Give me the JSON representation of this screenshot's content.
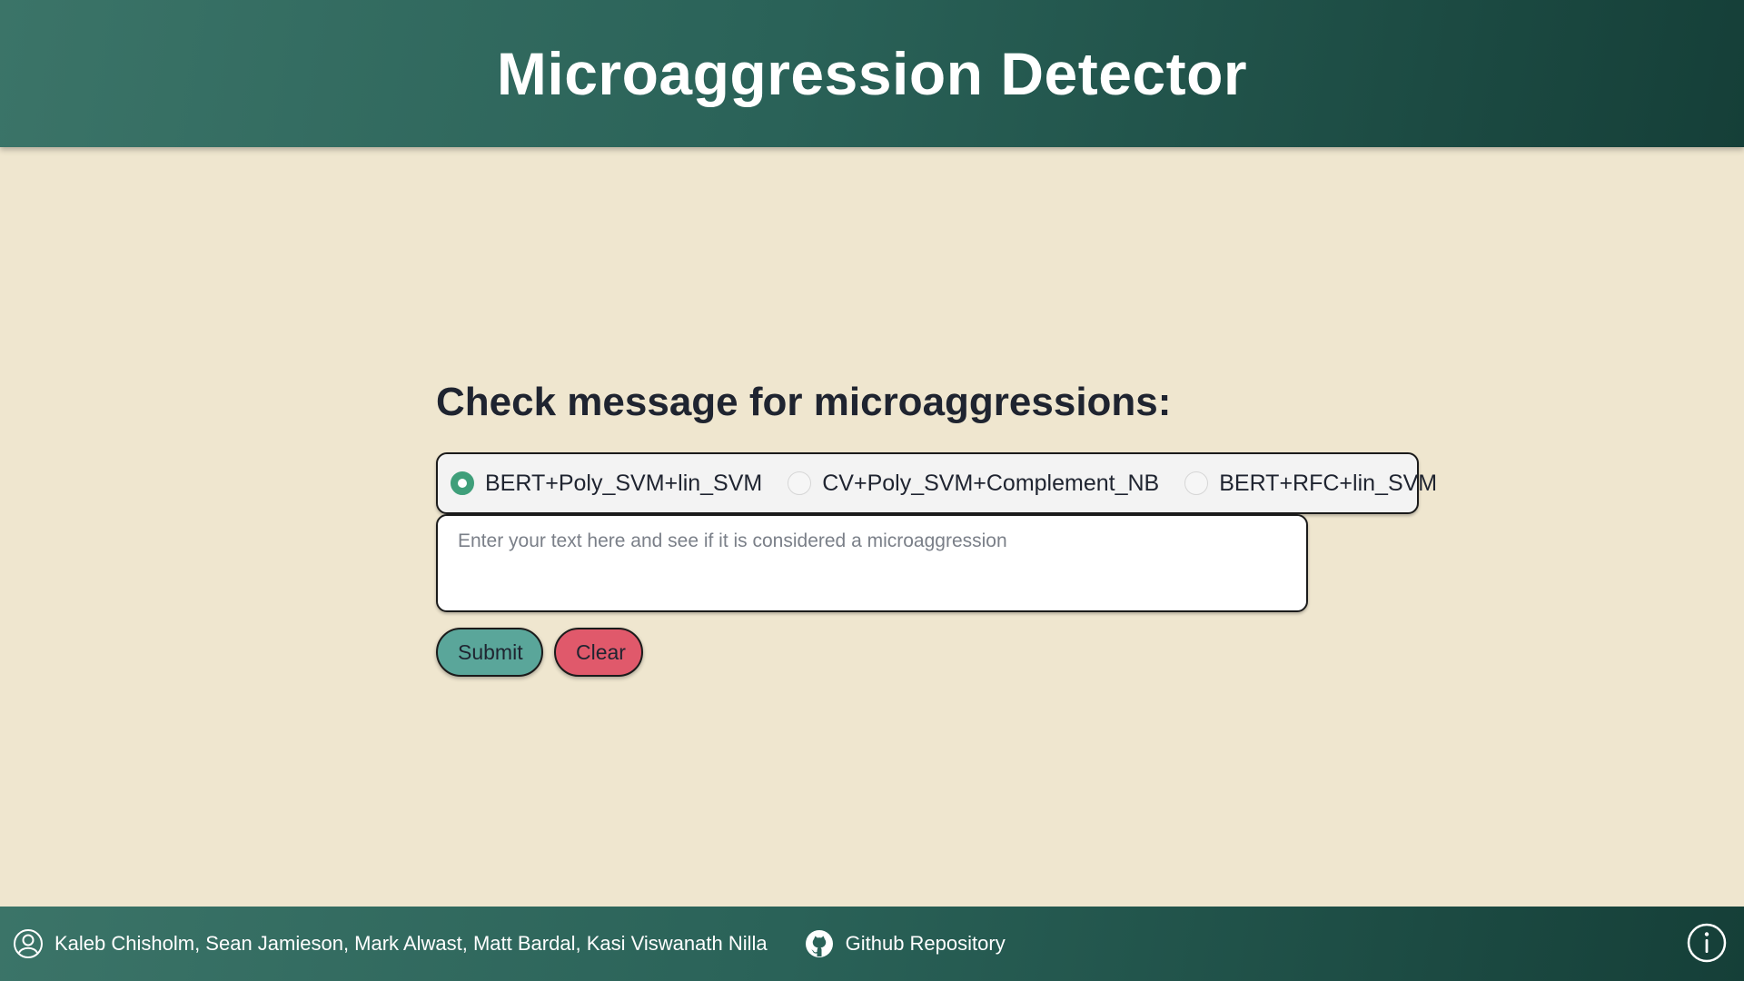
{
  "header": {
    "title": "Microaggression Detector"
  },
  "main": {
    "heading": "Check message for microaggressions:",
    "models": [
      {
        "label": "BERT+Poly_SVM+lin_SVM",
        "selected": true
      },
      {
        "label": "CV+Poly_SVM+Complement_NB",
        "selected": false
      },
      {
        "label": "BERT+RFC+lin_SVM",
        "selected": false
      }
    ],
    "input": {
      "placeholder": "Enter your text here and see if it is considered a microaggression",
      "value": ""
    },
    "submit_label": "Submit",
    "clear_label": "Clear"
  },
  "footer": {
    "authors": "Kaleb Chisholm, Sean Jamieson, Mark Alwast, Matt Bardal, Kasi Viswanath Nilla",
    "repo_label": "Github Repository",
    "icons": {
      "authors": "user-circle-icon",
      "repo": "github-icon",
      "info": "info-icon"
    }
  },
  "colors": {
    "header_bg": "#2a6258",
    "page_bg": "#efe6cf",
    "submit_bg": "#5aa69a",
    "clear_bg": "#e0596b",
    "radio_selected": "#3f9f7a"
  }
}
